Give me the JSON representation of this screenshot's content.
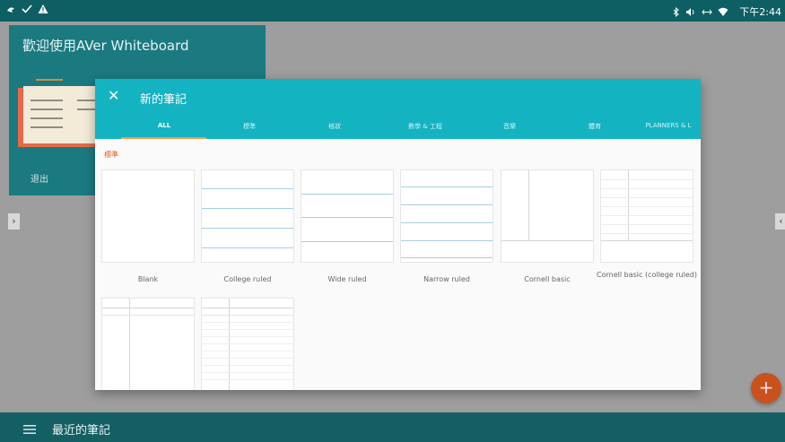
{
  "status_bar": {
    "time": "下午2:44",
    "icons": [
      "notification-icon",
      "check-icon",
      "warning-icon",
      "bluetooth-icon",
      "volume-icon",
      "data-icon",
      "wifi-icon"
    ]
  },
  "background": {
    "welcome_title": "歡迎使用AVer Whiteboard",
    "welcome_exit": "退出",
    "bottom_title": "最近的筆記",
    "fab_label": "+",
    "left_arrow": "›",
    "right_arrow": "‹"
  },
  "dialog": {
    "close_label": "✕",
    "title": "新的筆記",
    "tabs": [
      "ALL",
      "標準",
      "格狀",
      "數學 & 工程",
      "音樂",
      "體育",
      "PLANNERS & L"
    ],
    "active_tab": "ALL",
    "section_label": "標準",
    "templates": [
      "Blank",
      "College ruled",
      "Wide ruled",
      "Narrow ruled",
      "Cornell basic",
      "Cornell basic (college ruled)"
    ]
  },
  "colors": {
    "status_bar": "#0d5f63",
    "dialog_header": "#14b3c2",
    "tab_indicator": "#f2a04a",
    "section_label": "#e65b1c",
    "fab": "#c9521c",
    "bottom_bar": "#135f64",
    "welcome_card": "#1a7a80"
  }
}
